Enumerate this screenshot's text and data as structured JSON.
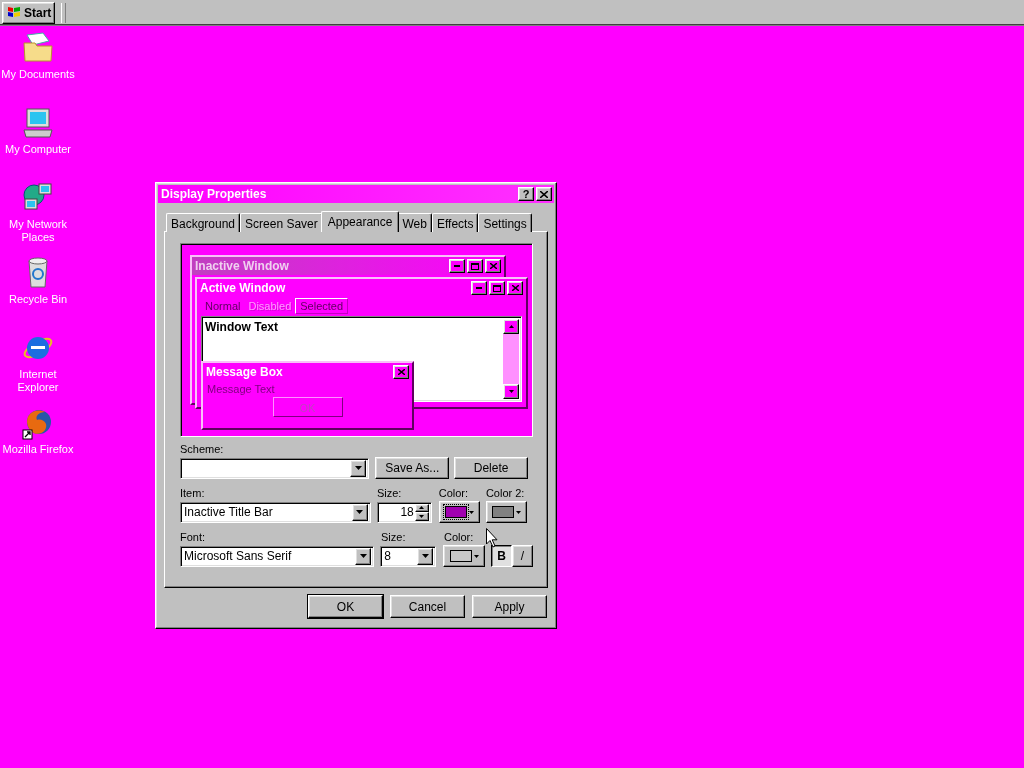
{
  "taskbar": {
    "start_label": "Start"
  },
  "desktop_icons": [
    {
      "label": "My Documents",
      "kind": "documents"
    },
    {
      "label": "My Computer",
      "kind": "computer"
    },
    {
      "label": "My Network Places",
      "kind": "network"
    },
    {
      "label": "Recycle Bin",
      "kind": "recycle"
    },
    {
      "label": "Internet Explorer",
      "kind": "ie"
    },
    {
      "label": "Mozilla Firefox",
      "kind": "firefox"
    }
  ],
  "dialog": {
    "title": "Display Properties",
    "help_label": "?",
    "tabs": [
      {
        "label": "Background",
        "selected": false
      },
      {
        "label": "Screen Saver",
        "selected": false
      },
      {
        "label": "Appearance",
        "selected": true
      },
      {
        "label": "Web",
        "selected": false
      },
      {
        "label": "Effects",
        "selected": false
      },
      {
        "label": "Settings",
        "selected": false
      }
    ],
    "preview": {
      "inactive_title": "Inactive Window",
      "active_title": "Active Window",
      "menu_items": [
        {
          "label": "Normal",
          "kind": "normal"
        },
        {
          "label": "Disabled",
          "kind": "disabled"
        },
        {
          "label": "Selected",
          "kind": "selected"
        }
      ],
      "window_text": "Window Text",
      "message_title": "Message Box",
      "message_text": "Message Text",
      "message_button": "OK"
    },
    "scheme": {
      "label": "Scheme:",
      "buttons": [
        "Save As...",
        "Delete"
      ]
    },
    "item": {
      "label": "Item:",
      "value": "Inactive Title Bar",
      "size_label": "Size:",
      "size": "18",
      "color_pickers": [
        {
          "label": "Color:",
          "color": "#a000b0",
          "focused": true
        },
        {
          "label": "Color 2:",
          "color": "#808080",
          "focused": false
        }
      ]
    },
    "font": {
      "label": "Font:",
      "value": "Microsoft Sans Serif",
      "size_label": "Size:",
      "size": "8",
      "color_label": "Color:",
      "color": "#c8c8c8",
      "bold": {
        "label": "B",
        "selected": true
      },
      "italic": {
        "label": "/",
        "selected": false
      }
    },
    "buttons": [
      "OK",
      "Cancel",
      "Apply"
    ]
  }
}
